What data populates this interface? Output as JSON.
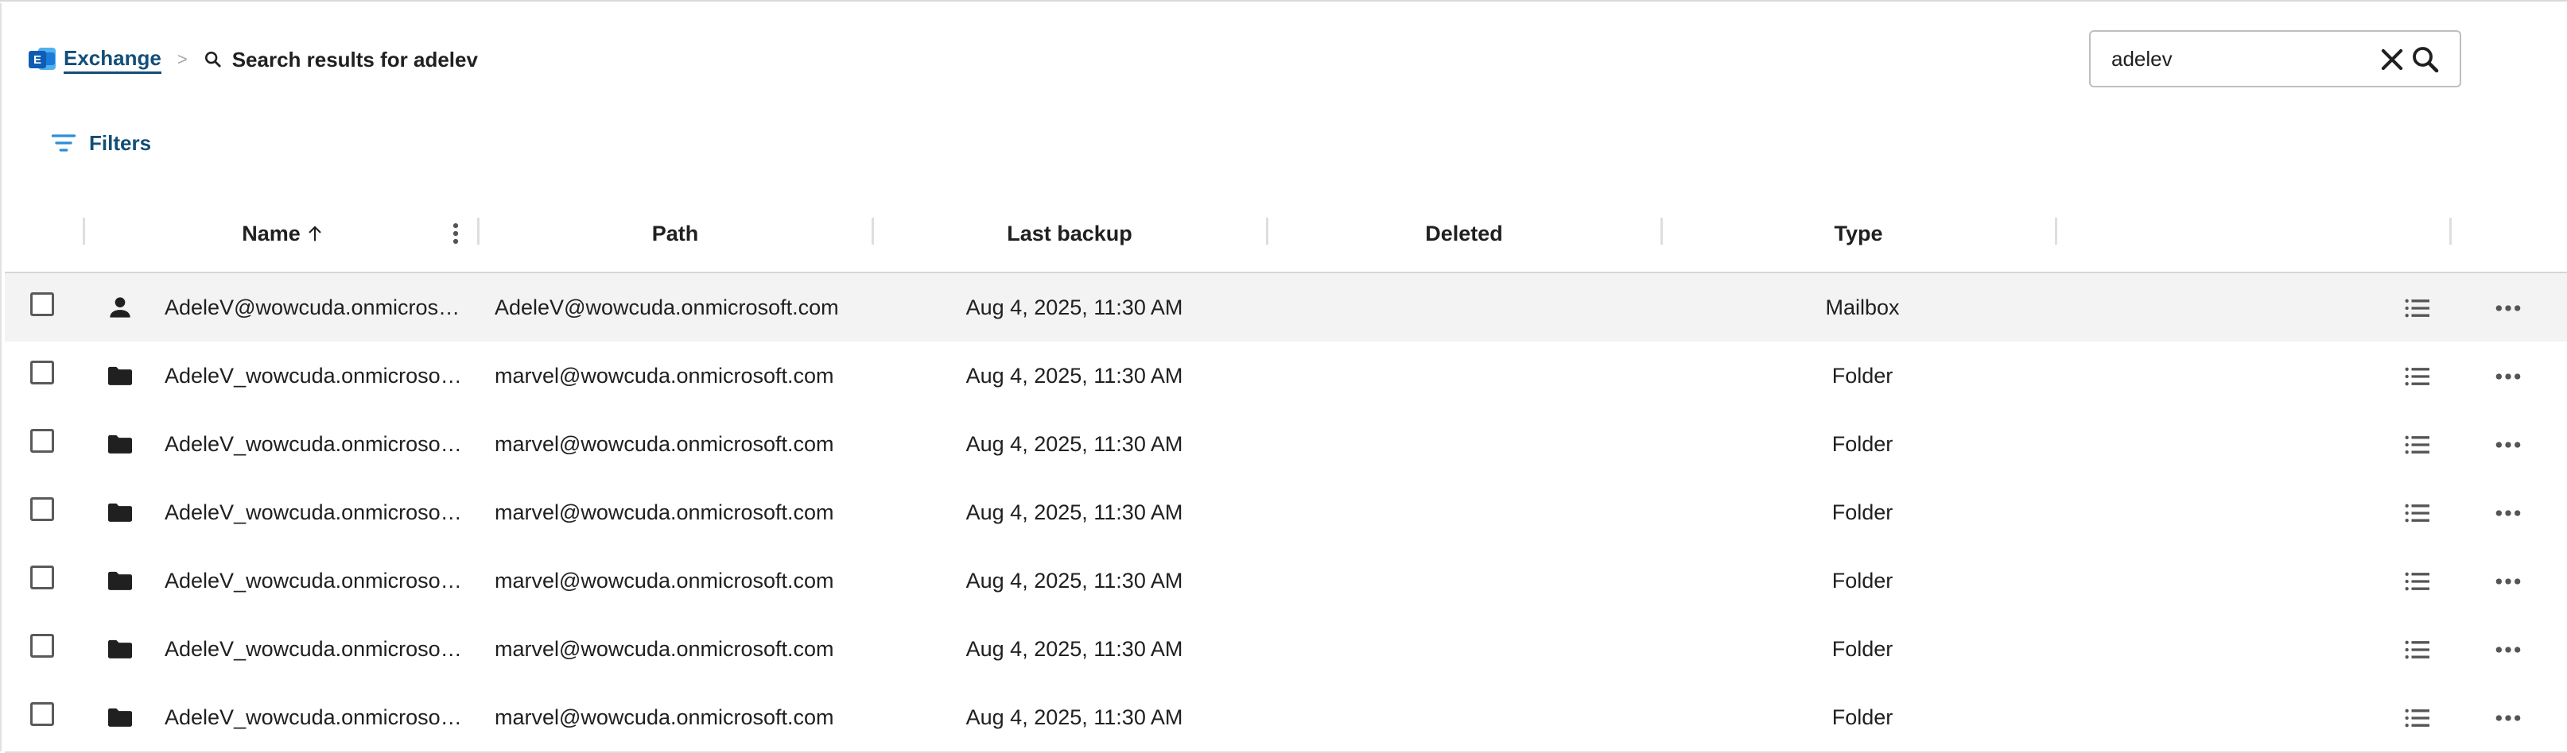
{
  "breadcrumb": {
    "app_label": "Exchange",
    "logo_letter": "E",
    "separator": ">",
    "current": "Search results for adelev"
  },
  "search": {
    "value": "adelev",
    "icon": "search-icon",
    "clear_icon": "close-icon"
  },
  "filters": {
    "label": "Filters",
    "icon": "filter-lines-icon"
  },
  "table": {
    "columns": [
      {
        "label": "Name",
        "sort": "ascending"
      },
      {
        "label": "Path"
      },
      {
        "label": "Last backup"
      },
      {
        "label": "Deleted"
      },
      {
        "label": "Type"
      }
    ],
    "rows": [
      {
        "icon": "person-icon",
        "name": "AdeleV@wowcuda.onmicrosoft.com",
        "path": "AdeleV@wowcuda.onmicrosoft.com",
        "last_backup": "Aug 4, 2025, 11:30 AM",
        "deleted": "",
        "type": "Mailbox"
      },
      {
        "icon": "folder-icon",
        "name": "AdeleV_wowcuda.onmicrosoft.com",
        "path": "marvel@wowcuda.onmicrosoft.com",
        "last_backup": "Aug 4, 2025, 11:30 AM",
        "deleted": "",
        "type": "Folder"
      },
      {
        "icon": "folder-icon",
        "name": "AdeleV_wowcuda.onmicrosoft.com",
        "path": "marvel@wowcuda.onmicrosoft.com",
        "last_backup": "Aug 4, 2025, 11:30 AM",
        "deleted": "",
        "type": "Folder"
      },
      {
        "icon": "folder-icon",
        "name": "AdeleV_wowcuda.onmicrosoft.com",
        "path": "marvel@wowcuda.onmicrosoft.com",
        "last_backup": "Aug 4, 2025, 11:30 AM",
        "deleted": "",
        "type": "Folder"
      },
      {
        "icon": "folder-icon",
        "name": "AdeleV_wowcuda.onmicrosoft.com",
        "path": "marvel@wowcuda.onmicrosoft.com",
        "last_backup": "Aug 4, 2025, 11:30 AM",
        "deleted": "",
        "type": "Folder"
      },
      {
        "icon": "folder-icon",
        "name": "AdeleV_wowcuda.onmicrosoft.com",
        "path": "marvel@wowcuda.onmicrosoft.com",
        "last_backup": "Aug 4, 2025, 11:30 AM",
        "deleted": "",
        "type": "Folder"
      },
      {
        "icon": "folder-icon",
        "name": "AdeleV_wowcuda.onmicrosoft.com",
        "path": "marvel@wowcuda.onmicrosoft.com",
        "last_backup": "Aug 4, 2025, 11:30 AM",
        "deleted": "",
        "type": "Folder"
      }
    ]
  },
  "colors": {
    "link": "#124e78",
    "brand_blue": "#0f5cb3",
    "filter_icon": "#2b8fd6",
    "row_highlight": "#f3f3f3"
  }
}
